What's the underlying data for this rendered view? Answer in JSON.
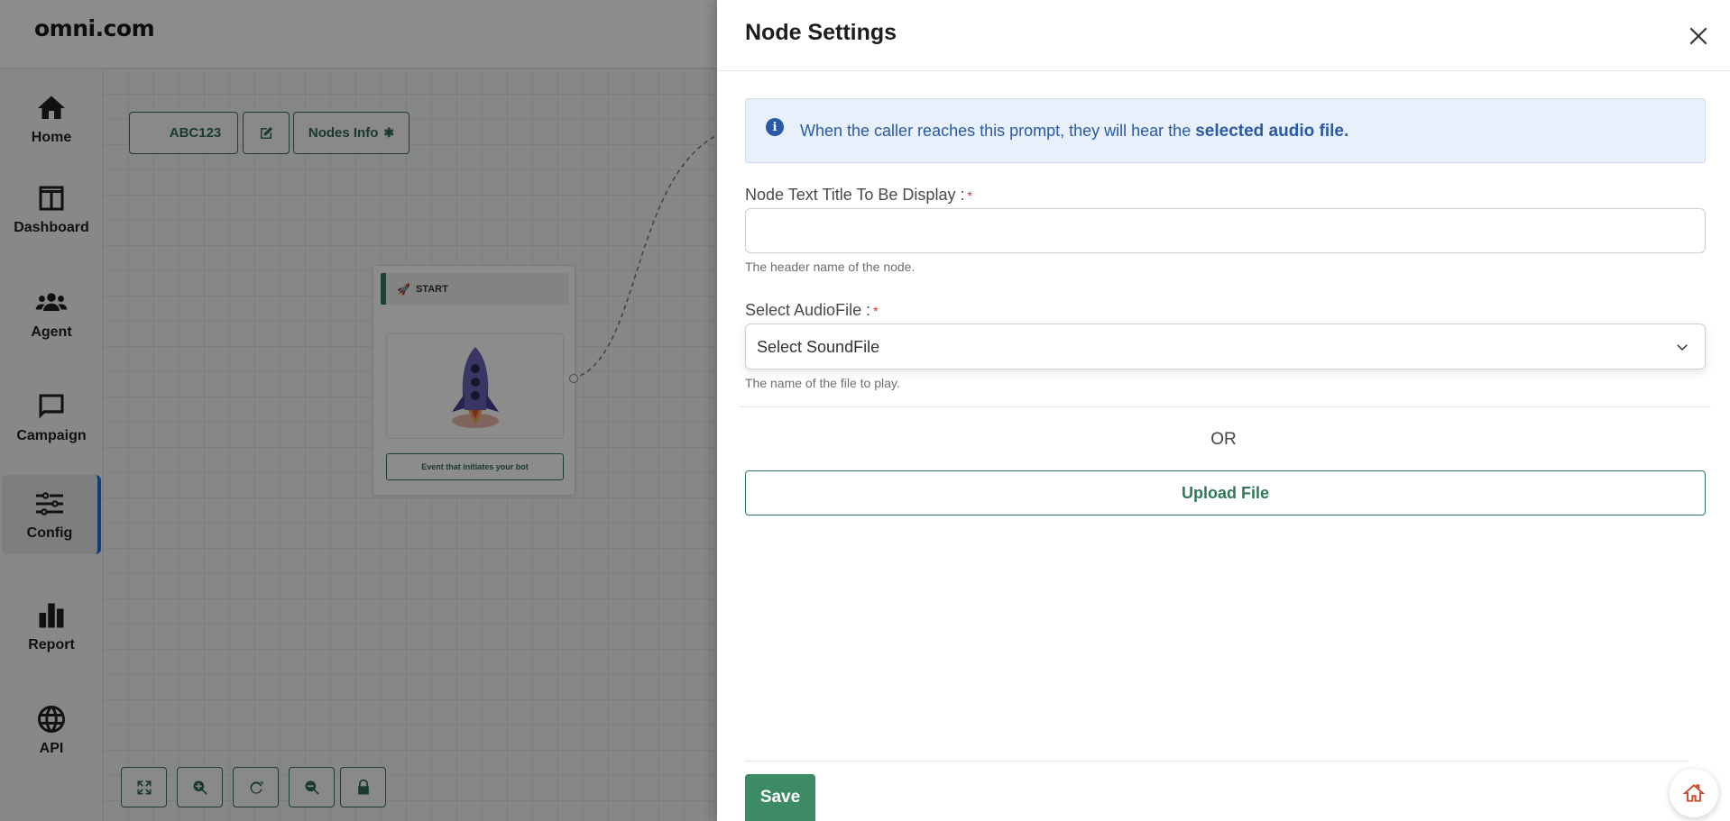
{
  "app": {
    "brand": "omni.com"
  },
  "sidebar": {
    "items": [
      {
        "label": "Home",
        "icon": "home-icon"
      },
      {
        "label": "Dashboard",
        "icon": "dashboard-icon"
      },
      {
        "label": "Agent",
        "icon": "agent-icon"
      },
      {
        "label": "Campaign",
        "icon": "campaign-icon"
      },
      {
        "label": "Config",
        "icon": "config-icon",
        "active": true
      },
      {
        "label": "Report",
        "icon": "report-icon"
      },
      {
        "label": "API",
        "icon": "api-icon"
      }
    ]
  },
  "canvas": {
    "flow_name": "ABC123",
    "edit_icon": "edit-icon",
    "nodes_info_label": "Nodes Info",
    "start_node": {
      "header": "START",
      "caption": "Event that initiates your bot"
    },
    "toolbar_icons": [
      "fit-screen-icon",
      "zoom-in-icon",
      "reset-icon",
      "zoom-out-icon",
      "lock-icon"
    ]
  },
  "drawer": {
    "title": "Node Settings",
    "info": {
      "text": "When the caller reaches this prompt, they will hear the ",
      "emphasis": "selected audio file."
    },
    "title_field": {
      "label": "Node Text Title To Be Display :",
      "required_mark": "*",
      "value": "",
      "help": "The header name of the node."
    },
    "audio_field": {
      "label": "Select AudioFile :",
      "required_mark": "*",
      "selected": "Select SoundFile",
      "help": "The name of the file to play."
    },
    "or_label": "OR",
    "upload_label": "Upload File",
    "save_label": "Save"
  },
  "colors": {
    "primary_green": "#3d8b64",
    "info_blue": "#2a5aa7",
    "info_bg": "#e8f1fb",
    "required_red": "#d12b2b"
  }
}
